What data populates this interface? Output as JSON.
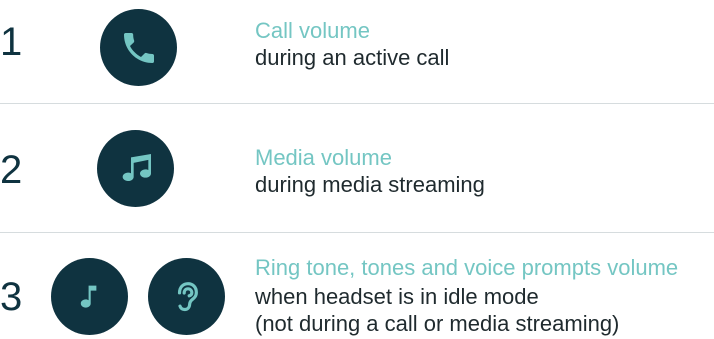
{
  "rows": [
    {
      "number": "1",
      "icons": [
        "phone-icon"
      ],
      "title": "Call volume",
      "description": [
        "during an active call"
      ]
    },
    {
      "number": "2",
      "icons": [
        "music-notes-icon"
      ],
      "title": "Media volume",
      "description": [
        "during media streaming"
      ]
    },
    {
      "number": "3",
      "icons": [
        "music-note-icon",
        "ear-icon"
      ],
      "title": "Ring tone, tones and voice prompts volume",
      "description": [
        "when headset is in idle mode",
        "(not during a call or media streaming)"
      ]
    }
  ],
  "colors": {
    "icon_background": "#0f3340",
    "icon_glyph": "#74c6c3",
    "title": "#74c6c3",
    "text": "#1f2a2e",
    "number": "#0f3340",
    "divider": "#d6dcde"
  }
}
